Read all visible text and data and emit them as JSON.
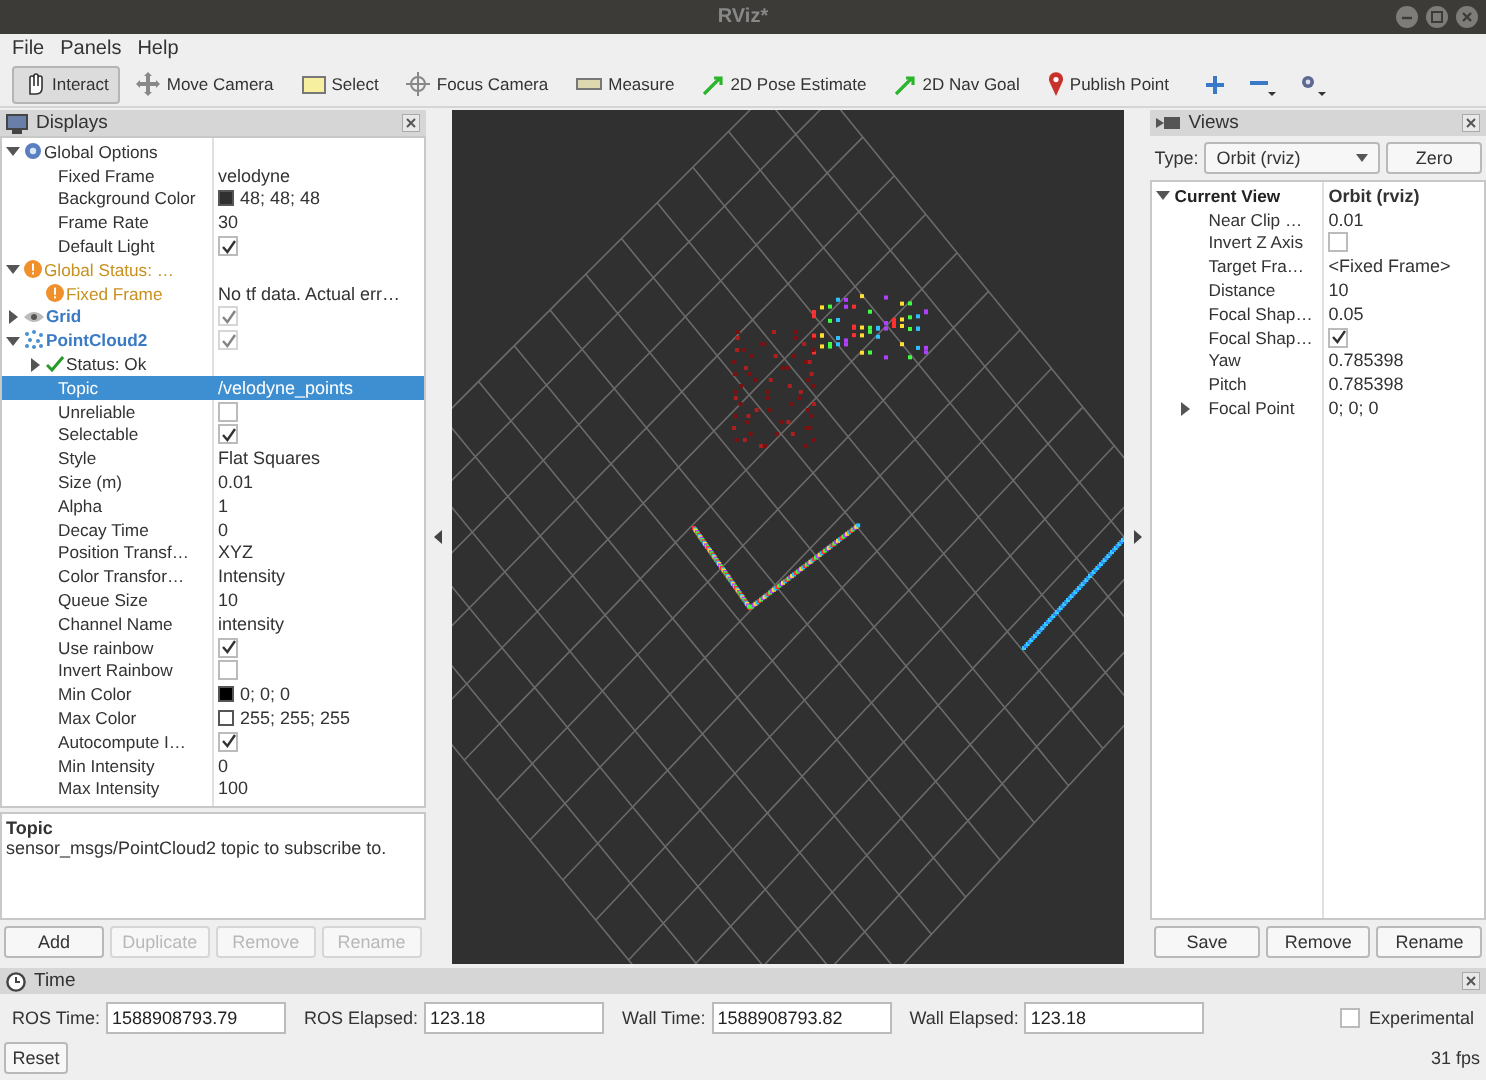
{
  "window": {
    "title": "RViz*"
  },
  "menu": [
    "File",
    "Panels",
    "Help"
  ],
  "tools": [
    {
      "label": "Interact",
      "kind": "hand",
      "selected": true
    },
    {
      "label": "Move Camera",
      "kind": "move",
      "selected": false
    },
    {
      "label": "Select",
      "kind": "select",
      "selected": false
    },
    {
      "label": "Focus Camera",
      "kind": "focus",
      "selected": false
    },
    {
      "label": "Measure",
      "kind": "ruler",
      "selected": false
    },
    {
      "label": "2D Pose Estimate",
      "kind": "arrow",
      "selected": false
    },
    {
      "label": "2D Nav Goal",
      "kind": "arrow",
      "selected": false
    },
    {
      "label": "Publish Point",
      "kind": "pin",
      "selected": false
    }
  ],
  "displays": {
    "title": "Displays",
    "items": [
      {
        "label": "Global Options",
        "kind": "options",
        "expanded": true,
        "selected": false,
        "children": [
          {
            "label": "Fixed Frame",
            "kind": "property",
            "value": "velodyne",
            "selected": false
          },
          {
            "label": "Background Color",
            "kind": "property",
            "value": "48; 48; 48",
            "color": "#303030",
            "selected": false
          },
          {
            "label": "Frame Rate",
            "kind": "property",
            "value": "30",
            "selected": false
          },
          {
            "label": "Default Light",
            "kind": "property",
            "checked": true,
            "selected": false
          }
        ]
      },
      {
        "label": "Global Status: …",
        "kind": "warning",
        "expanded": true,
        "selected": false,
        "children": [
          {
            "label": "Fixed Frame",
            "kind": "warning",
            "value": "No tf data.  Actual err…",
            "selected": false
          }
        ]
      },
      {
        "label": "Grid",
        "kind": "grid",
        "expanded": false,
        "checked": true,
        "selected": false
      },
      {
        "label": "PointCloud2",
        "kind": "cloud",
        "expanded": true,
        "checked": true,
        "selected": false,
        "children": [
          {
            "label": "Status: Ok",
            "kind": "ok",
            "expanded": false,
            "selected": false
          },
          {
            "label": "Topic",
            "kind": "property",
            "value": "/velodyne_points",
            "selected": true
          },
          {
            "label": "Unreliable",
            "kind": "property",
            "checked": false,
            "selected": false
          },
          {
            "label": "Selectable",
            "kind": "property",
            "checked": true,
            "selected": false
          },
          {
            "label": "Style",
            "kind": "property",
            "value": "Flat Squares",
            "selected": false
          },
          {
            "label": "Size (m)",
            "kind": "property",
            "value": "0.01",
            "selected": false
          },
          {
            "label": "Alpha",
            "kind": "property",
            "value": "1",
            "selected": false
          },
          {
            "label": "Decay Time",
            "kind": "property",
            "value": "0",
            "selected": false
          },
          {
            "label": "Position Transf…",
            "kind": "property",
            "value": "XYZ",
            "selected": false
          },
          {
            "label": "Color Transfor…",
            "kind": "property",
            "value": "Intensity",
            "selected": false
          },
          {
            "label": "Queue Size",
            "kind": "property",
            "value": "10",
            "selected": false
          },
          {
            "label": "Channel Name",
            "kind": "property",
            "value": "intensity",
            "selected": false
          },
          {
            "label": "Use rainbow",
            "kind": "property",
            "checked": true,
            "selected": false
          },
          {
            "label": "Invert Rainbow",
            "kind": "property",
            "checked": false,
            "selected": false
          },
          {
            "label": "Min Color",
            "kind": "property",
            "value": "0; 0; 0",
            "color": "#000000",
            "selected": false
          },
          {
            "label": "Max Color",
            "kind": "property",
            "value": "255; 255; 255",
            "color": "#ffffff",
            "selected": false
          },
          {
            "label": "Autocompute I…",
            "kind": "property",
            "checked": true,
            "selected": false
          },
          {
            "label": "Min Intensity",
            "kind": "property",
            "value": "0",
            "selected": false
          },
          {
            "label": "Max Intensity",
            "kind": "property",
            "value": "100",
            "selected": false
          }
        ]
      }
    ],
    "description": {
      "title": "Topic",
      "text": "sensor_msgs/PointCloud2 topic to subscribe to."
    },
    "buttons": [
      {
        "label": "Add",
        "disabled": false
      },
      {
        "label": "Duplicate",
        "disabled": true
      },
      {
        "label": "Remove",
        "disabled": true
      },
      {
        "label": "Rename",
        "disabled": true
      }
    ]
  },
  "views": {
    "title": "Views",
    "type_label": "Type:",
    "type_value": "Orbit (rviz)",
    "zero_button": "Zero",
    "items": [
      {
        "label": "Current View",
        "kind": "view",
        "value": "Orbit (rviz)",
        "expanded": true,
        "selected": false,
        "children": [
          {
            "label": "Near Clip …",
            "kind": "property",
            "value": "0.01",
            "selected": false
          },
          {
            "label": "Invert Z Axis",
            "kind": "property",
            "checked": false,
            "selected": false
          },
          {
            "label": "Target Fra…",
            "kind": "property",
            "value": "<Fixed Frame>",
            "selected": false
          },
          {
            "label": "Distance",
            "kind": "property",
            "value": "10",
            "selected": false
          },
          {
            "label": "Focal Shap…",
            "kind": "property",
            "value": "0.05",
            "selected": false
          },
          {
            "label": "Focal Shap…",
            "kind": "property",
            "checked": true,
            "selected": false
          },
          {
            "label": "Yaw",
            "kind": "property",
            "value": "0.785398",
            "selected": false
          },
          {
            "label": "Pitch",
            "kind": "property",
            "value": "0.785398",
            "selected": false
          },
          {
            "label": "Focal Point",
            "kind": "property",
            "value": "0; 0; 0",
            "expanded": false,
            "selected": false
          }
        ]
      }
    ],
    "buttons": [
      {
        "label": "Save",
        "disabled": false
      },
      {
        "label": "Remove",
        "disabled": false
      },
      {
        "label": "Rename",
        "disabled": false
      }
    ]
  },
  "time": {
    "title": "Time",
    "fields": [
      {
        "label": "ROS Time:",
        "value": "1588908793.79"
      },
      {
        "label": "ROS Elapsed:",
        "value": "123.18"
      },
      {
        "label": "Wall Time:",
        "value": "1588908793.82"
      },
      {
        "label": "Wall Elapsed:",
        "value": "123.18"
      }
    ],
    "experimental": {
      "label": "Experimental",
      "checked": false
    },
    "reset_button": "Reset",
    "fps": "31 fps"
  }
}
